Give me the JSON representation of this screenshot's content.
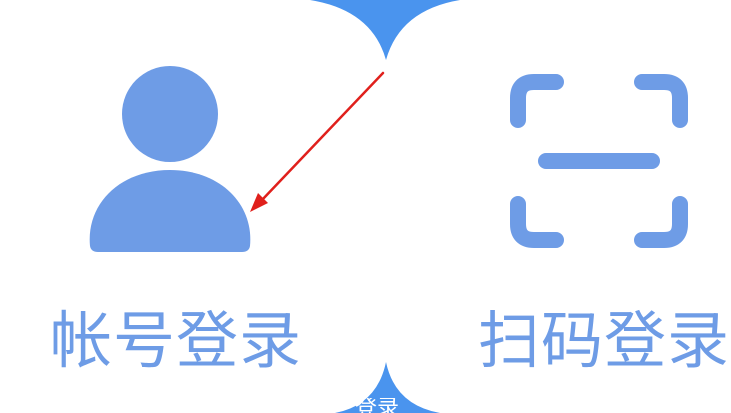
{
  "colors": {
    "accent": "#6e9ce6",
    "background_blue": "#4a94ee",
    "card": "#ffffff",
    "annotation_arrow": "#e0201c"
  },
  "login_options": [
    {
      "label": "帐号登录",
      "icon": "user-icon"
    },
    {
      "label": "扫码登录",
      "icon": "scan-icon"
    }
  ],
  "bottom_partial_text": "登录"
}
